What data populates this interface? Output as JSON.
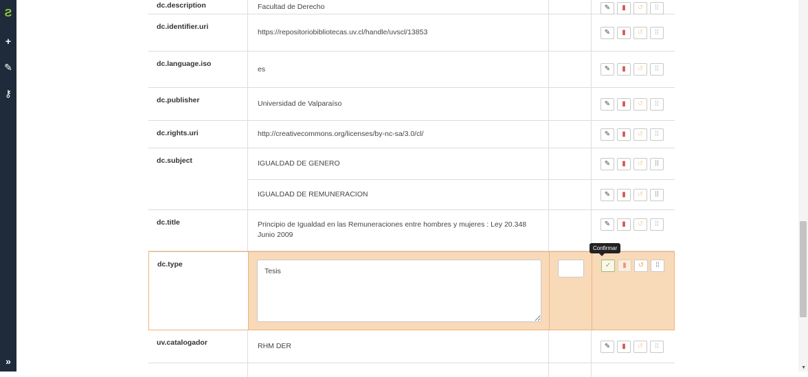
{
  "sidebar": {
    "icons": [
      "logo-icon",
      "plus-icon",
      "pencil-icon",
      "key-icon",
      "expand-icon"
    ]
  },
  "rows": [
    {
      "key": "dc.description",
      "values": [
        "Facultad de Derecho"
      ]
    },
    {
      "key": "dc.identifier.uri",
      "values": [
        "https://repositoriobibliotecas.uv.cl/handle/uvscl/13853"
      ]
    },
    {
      "key": "dc.language.iso",
      "values": [
        "es"
      ]
    },
    {
      "key": "dc.publisher",
      "values": [
        "Universidad de Valparaíso"
      ]
    },
    {
      "key": "dc.rights.uri",
      "values": [
        "http://creativecommons.org/licenses/by-nc-sa/3.0/cl/"
      ]
    },
    {
      "key": "dc.subject",
      "values": [
        "IGUALDAD DE GENERO",
        "IGUALDAD DE REMUNERACION"
      ]
    },
    {
      "key": "dc.title",
      "values": [
        "Principio de Igualdad en las Remuneraciones entre hombres y mujeres : Ley 20.348 Junio 2009"
      ]
    },
    {
      "key": "dc.type",
      "values": [
        "Tesis"
      ],
      "editing": true
    },
    {
      "key": "uv.catalogador",
      "values": [
        "RHM DER"
      ]
    }
  ],
  "tooltip": {
    "text": "Confirmar"
  },
  "colors": {
    "sidebar": "#1f2b3a",
    "logo": "#8ecb3c",
    "edit_row_bg": "#f8d9b8",
    "delete": "#d9534f",
    "undo": "#f0ad4e",
    "confirm": "#5cb85c"
  }
}
